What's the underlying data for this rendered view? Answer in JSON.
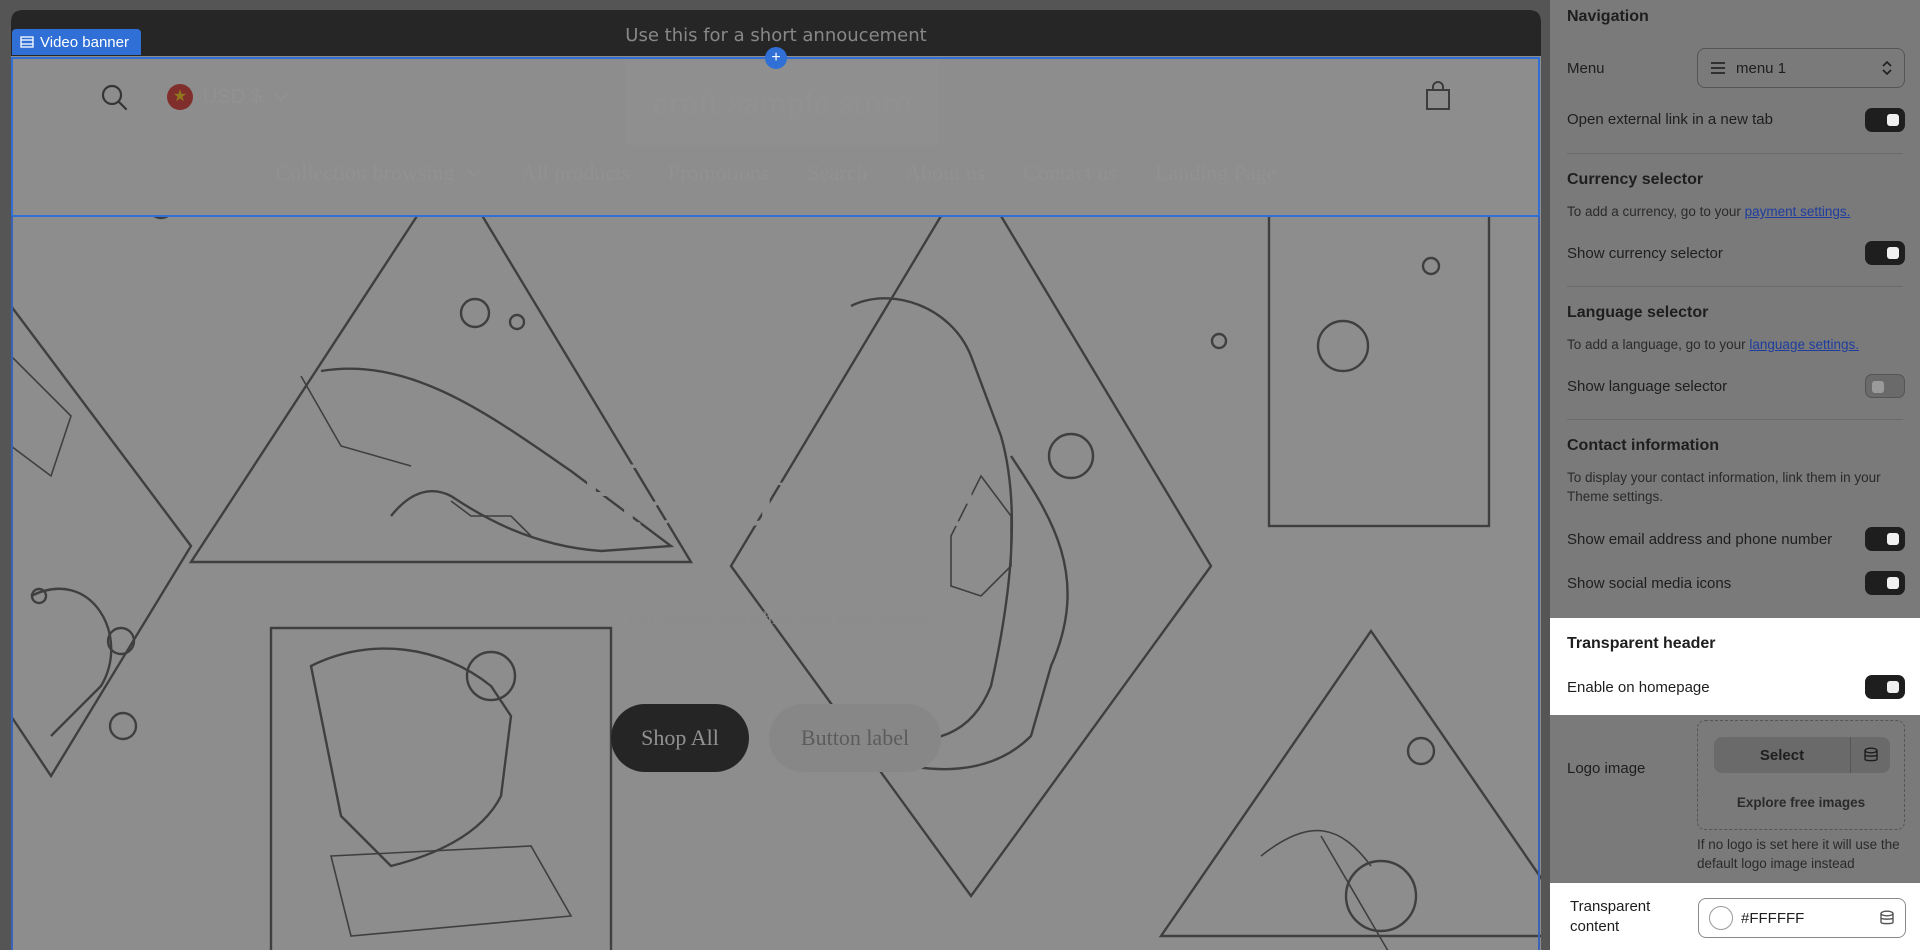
{
  "preview": {
    "section_tag": "Video banner",
    "announcement": "Use this for a short annoucement",
    "currency": "USD $",
    "store_name": "craft sample store",
    "nav": [
      {
        "label": "Collection browsing",
        "has_dropdown": true
      },
      {
        "label": "All products"
      },
      {
        "label": "Promotions"
      },
      {
        "label": "Search"
      },
      {
        "label": "About us"
      },
      {
        "label": "Contact us"
      },
      {
        "label": "Landing Page"
      }
    ],
    "hero": {
      "title": "Handmade",
      "subtitle": "You deserve everything your heart desires",
      "primary_button": "Shop All",
      "secondary_button": "Button label"
    }
  },
  "panel": {
    "navigation": {
      "title": "Navigation",
      "menu_label": "Menu",
      "menu_value": "menu 1",
      "external_link_label": "Open external link in a new tab",
      "external_link_on": true
    },
    "currency": {
      "title": "Currency selector",
      "help_prefix": "To add a currency, go to your ",
      "help_link": "payment settings.",
      "toggle_label": "Show currency selector",
      "toggle_on": true
    },
    "language": {
      "title": "Language selector",
      "help_prefix": "To add a language, go to your ",
      "help_link": "language settings.",
      "toggle_label": "Show language selector",
      "toggle_on": false
    },
    "contact": {
      "title": "Contact information",
      "help": "To display your contact information, link them in your Theme settings.",
      "email_label": "Show email address and phone number",
      "email_on": true,
      "social_label": "Show social media icons",
      "social_on": true
    },
    "transparent": {
      "title": "Transparent header",
      "enable_label": "Enable on homepage",
      "enable_on": true
    },
    "logo": {
      "label": "Logo image",
      "select_label": "Select",
      "explore_label": "Explore free images",
      "help": "If no logo is set here it will use the default logo image instead"
    },
    "transparent_content": {
      "label": "Transparent content",
      "value": "#FFFFFF"
    }
  },
  "colors": {
    "accent": "#2f6fd6",
    "toggle_on": "#1e1e1e",
    "announcement_bg": "#121212",
    "link": "#1f3d9e"
  }
}
